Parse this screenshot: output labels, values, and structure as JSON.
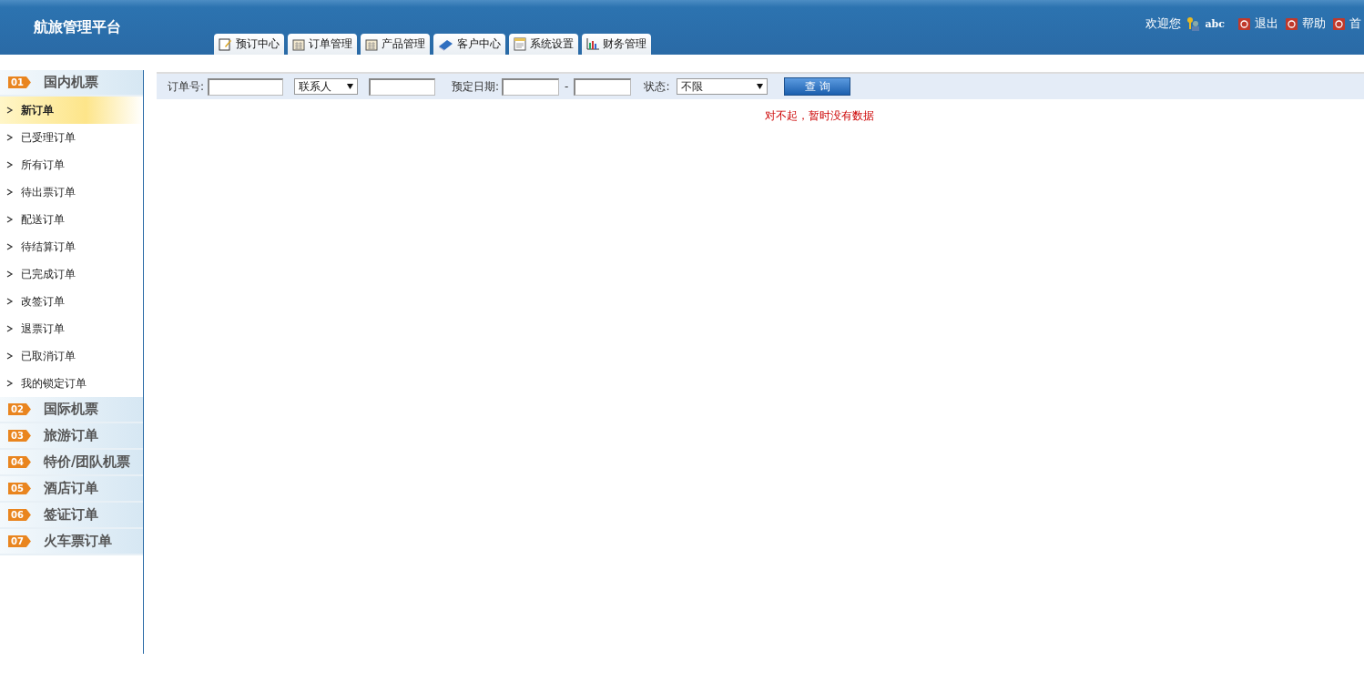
{
  "header": {
    "title": "航旅管理平台",
    "welcome": "欢迎您",
    "user": "abc",
    "links": [
      {
        "label": "退出"
      },
      {
        "label": "帮助"
      },
      {
        "label": "首"
      }
    ]
  },
  "tabs": [
    {
      "label": "预订中心",
      "kind": "edit"
    },
    {
      "label": "订单管理",
      "kind": "calendar"
    },
    {
      "label": "产品管理",
      "kind": "calendar"
    },
    {
      "label": "客户中心",
      "kind": "book"
    },
    {
      "label": "系统设置",
      "kind": "document"
    },
    {
      "label": "财务管理",
      "kind": "chart"
    }
  ],
  "sidebar": {
    "groups": [
      {
        "number": "01",
        "label": "国内机票",
        "children": [
          {
            "label": "新订单",
            "selected": true
          },
          {
            "label": "已受理订单",
            "selected": false
          },
          {
            "label": "所有订单",
            "selected": false
          },
          {
            "label": "待出票订单",
            "selected": false
          },
          {
            "label": "配送订单",
            "selected": false
          },
          {
            "label": "待结算订单",
            "selected": false
          },
          {
            "label": "已完成订单",
            "selected": false
          },
          {
            "label": "改签订单",
            "selected": false
          },
          {
            "label": "退票订单",
            "selected": false
          },
          {
            "label": "已取消订单",
            "selected": false
          },
          {
            "label": "我的锁定订单",
            "selected": false
          }
        ]
      },
      {
        "number": "02",
        "label": "国际机票"
      },
      {
        "number": "03",
        "label": "旅游订单"
      },
      {
        "number": "04",
        "label": "特价/团队机票"
      },
      {
        "number": "05",
        "label": "酒店订单"
      },
      {
        "number": "06",
        "label": "签证订单"
      },
      {
        "number": "07",
        "label": "火车票订单"
      }
    ]
  },
  "search": {
    "order_label": "订单号:",
    "contact_select": "联系人",
    "date_label": "预定日期:",
    "date_separator": "-",
    "status_label": "状态:",
    "status_select": "不限",
    "button": "查 询"
  },
  "message": "对不起，暂时没有数据"
}
